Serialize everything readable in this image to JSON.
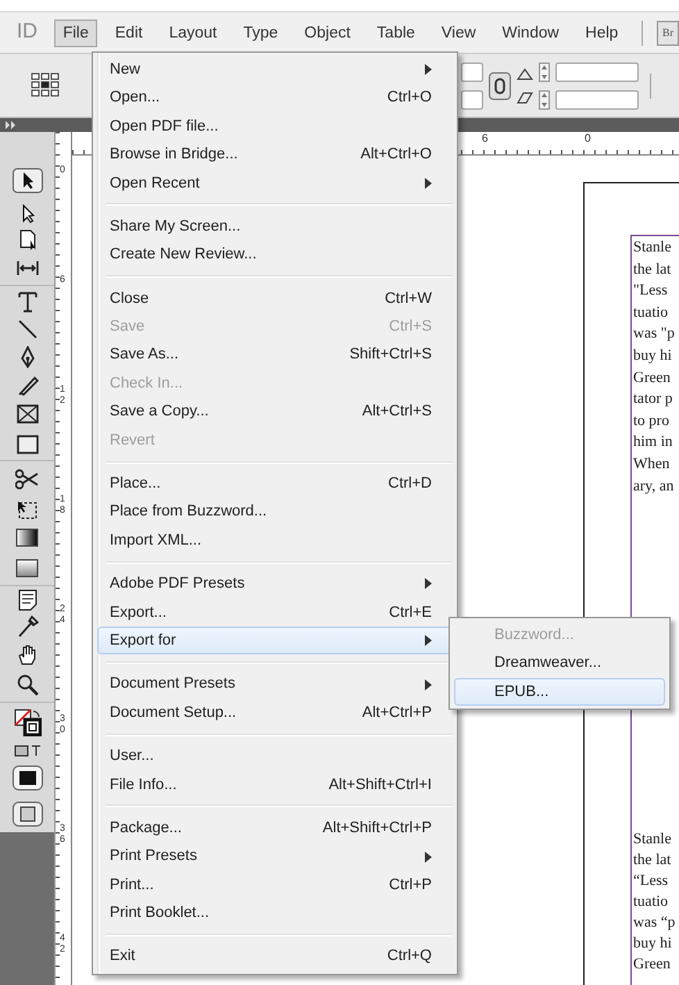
{
  "app_logo": "ID",
  "menu_bar": [
    {
      "label": "File",
      "selected": true
    },
    {
      "label": "Edit",
      "selected": false
    },
    {
      "label": "Layout",
      "selected": false
    },
    {
      "label": "Type",
      "selected": false
    },
    {
      "label": "Object",
      "selected": false
    },
    {
      "label": "Table",
      "selected": false
    },
    {
      "label": "View",
      "selected": false
    },
    {
      "label": "Window",
      "selected": false
    },
    {
      "label": "Help",
      "selected": false
    }
  ],
  "bridge_button": "Br",
  "horizontal_ruler_labels": [
    "6",
    "0"
  ],
  "vertical_ruler_labels": [
    "0",
    "6",
    "12",
    "18",
    "24",
    "30",
    "36",
    "42"
  ],
  "document_text": [
    [
      "Stanle",
      "the lat",
      "\"Less",
      "tuatio",
      "was \"p",
      "buy hi",
      "Green",
      "tator p",
      "to pro",
      "him in",
      "When",
      "ary, an"
    ],
    [
      "Stanle",
      "the lat",
      "“Less",
      "tuatio",
      "was “p",
      "buy hi",
      "Green"
    ]
  ],
  "file_menu": [
    [
      {
        "label": "New",
        "submenu": true,
        "disabled": false,
        "selected": false
      },
      {
        "label": "Open...",
        "shortcut": "Ctrl+O",
        "submenu": false,
        "disabled": false,
        "selected": false
      },
      {
        "label": "Open PDF file...",
        "submenu": false,
        "disabled": false,
        "selected": false
      },
      {
        "label": "Browse in Bridge...",
        "shortcut": "Alt+Ctrl+O",
        "submenu": false,
        "disabled": false,
        "selected": false
      },
      {
        "label": "Open Recent",
        "submenu": true,
        "disabled": false,
        "selected": false
      }
    ],
    [
      {
        "label": "Share My Screen...",
        "submenu": false,
        "disabled": false,
        "selected": false
      },
      {
        "label": "Create New Review...",
        "submenu": false,
        "disabled": false,
        "selected": false
      }
    ],
    [
      {
        "label": "Close",
        "shortcut": "Ctrl+W",
        "submenu": false,
        "disabled": false,
        "selected": false
      },
      {
        "label": "Save",
        "shortcut": "Ctrl+S",
        "submenu": false,
        "disabled": true,
        "selected": false
      },
      {
        "label": "Save As...",
        "shortcut": "Shift+Ctrl+S",
        "submenu": false,
        "disabled": false,
        "selected": false
      },
      {
        "label": "Check In...",
        "submenu": false,
        "disabled": true,
        "selected": false
      },
      {
        "label": "Save a Copy...",
        "shortcut": "Alt+Ctrl+S",
        "submenu": false,
        "disabled": false,
        "selected": false
      },
      {
        "label": "Revert",
        "submenu": false,
        "disabled": true,
        "selected": false
      }
    ],
    [
      {
        "label": "Place...",
        "shortcut": "Ctrl+D",
        "submenu": false,
        "disabled": false,
        "selected": false
      },
      {
        "label": "Place from Buzzword...",
        "submenu": false,
        "disabled": false,
        "selected": false
      },
      {
        "label": "Import XML...",
        "submenu": false,
        "disabled": false,
        "selected": false
      }
    ],
    [
      {
        "label": "Adobe PDF Presets",
        "submenu": true,
        "disabled": false,
        "selected": false
      },
      {
        "label": "Export...",
        "shortcut": "Ctrl+E",
        "submenu": false,
        "disabled": false,
        "selected": false
      },
      {
        "label": "Export for",
        "submenu": true,
        "disabled": false,
        "selected": true
      }
    ],
    [
      {
        "label": "Document Presets",
        "submenu": true,
        "disabled": false,
        "selected": false
      },
      {
        "label": "Document Setup...",
        "shortcut": "Alt+Ctrl+P",
        "submenu": false,
        "disabled": false,
        "selected": false
      }
    ],
    [
      {
        "label": "User...",
        "submenu": false,
        "disabled": false,
        "selected": false
      },
      {
        "label": "File Info...",
        "shortcut": "Alt+Shift+Ctrl+I",
        "submenu": false,
        "disabled": false,
        "selected": false
      }
    ],
    [
      {
        "label": "Package...",
        "shortcut": "Alt+Shift+Ctrl+P",
        "submenu": false,
        "disabled": false,
        "selected": false
      },
      {
        "label": "Print Presets",
        "submenu": true,
        "disabled": false,
        "selected": false
      },
      {
        "label": "Print...",
        "shortcut": "Ctrl+P",
        "submenu": false,
        "disabled": false,
        "selected": false
      },
      {
        "label": "Print Booklet...",
        "submenu": false,
        "disabled": false,
        "selected": false
      }
    ],
    [
      {
        "label": "Exit",
        "shortcut": "Ctrl+Q",
        "submenu": false,
        "disabled": false,
        "selected": false
      }
    ]
  ],
  "export_for_submenu": [
    {
      "label": "Buzzword...",
      "disabled": true,
      "selected": false
    },
    {
      "label": "Dreamweaver...",
      "disabled": false,
      "selected": false
    },
    {
      "label": "EPUB...",
      "disabled": false,
      "selected": true
    }
  ]
}
